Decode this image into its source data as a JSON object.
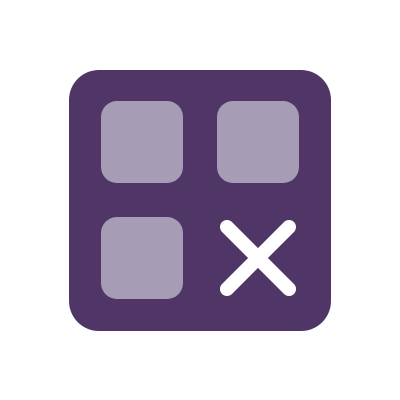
{
  "icon": {
    "name": "grid-remove-app-icon",
    "background_color": "#4f3667",
    "tile_color": "#a79cb5",
    "x_color": "#ffffff",
    "tiles": [
      {
        "name": "tile-top-left"
      },
      {
        "name": "tile-top-right"
      },
      {
        "name": "tile-bottom-left"
      }
    ],
    "remove_glyph": "close-icon"
  }
}
